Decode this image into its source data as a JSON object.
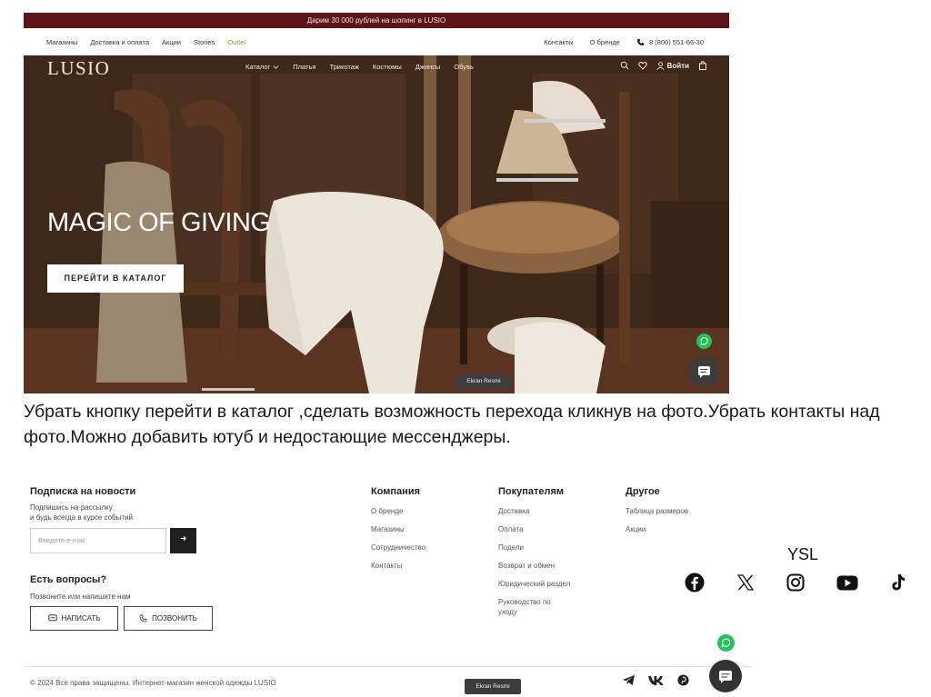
{
  "site": {
    "promo": "Дарим 30 000 рублей на шопинг в LUSIO",
    "util_left": [
      "Магазины",
      "Доставка и оплата",
      "Акции",
      "Stories",
      "Outlet"
    ],
    "util_right": [
      "Контакты",
      "О бренде"
    ],
    "phone": "8 (800) 551-66-30",
    "logo": "LUSIO",
    "menu": [
      "Каталог",
      "Платья",
      "Трикотаж",
      "Костюмы",
      "Джинсы",
      "Обувь"
    ],
    "login": "Войти",
    "hero_title": "MAGIC OF GIVING",
    "hero_button": "ПЕРЕЙТИ В КАТАЛОГ",
    "ekran_badge": "Ekran Resmi"
  },
  "annotation": "Убрать кнопку перейти в каталог ,сделать возможность перехода кликнув на фото.Убрать контакты над фото.Можно добавить ютуб и недостающие мессенджеры.",
  "footer": {
    "subscribe_title": "Подписка на новости",
    "subscribe_desc_1": "Подпишись на рассылку",
    "subscribe_desc_2": "и будь всегда в курсе событий",
    "email_placeholder": "Введите e-mail",
    "questions_title": "Есть вопросы?",
    "questions_desc": "Позвоните или напишите нам",
    "write_button": "НАПИСАТЬ",
    "call_button": "ПОЗВОНИТЬ",
    "company": {
      "title": "Компания",
      "links": [
        "О бренде",
        "Магазины",
        "Сотрудничество",
        "Контакты"
      ]
    },
    "buyers": {
      "title": "Покупателям",
      "links": [
        "Доставка",
        "Оплата",
        "Подели",
        "Возврат и обмен",
        "Юридический раздел",
        "Руководство по уходу"
      ]
    },
    "other": {
      "title": "Другое",
      "links": [
        "Таблица размеров",
        "Акции"
      ]
    },
    "copyright": "© 2024 Все права защищены. Интернет-магазин женской одежды LUSIO",
    "ekran_badge": "Ekran Resmi"
  },
  "ysl_label": "YSL",
  "social_icons": [
    "facebook-icon",
    "x-icon",
    "instagram-icon",
    "youtube-icon",
    "tiktok-icon"
  ],
  "colors": {
    "promo_bg": "#5e1316",
    "outlet": "#b48a3c",
    "whatsapp": "#25c15a"
  }
}
